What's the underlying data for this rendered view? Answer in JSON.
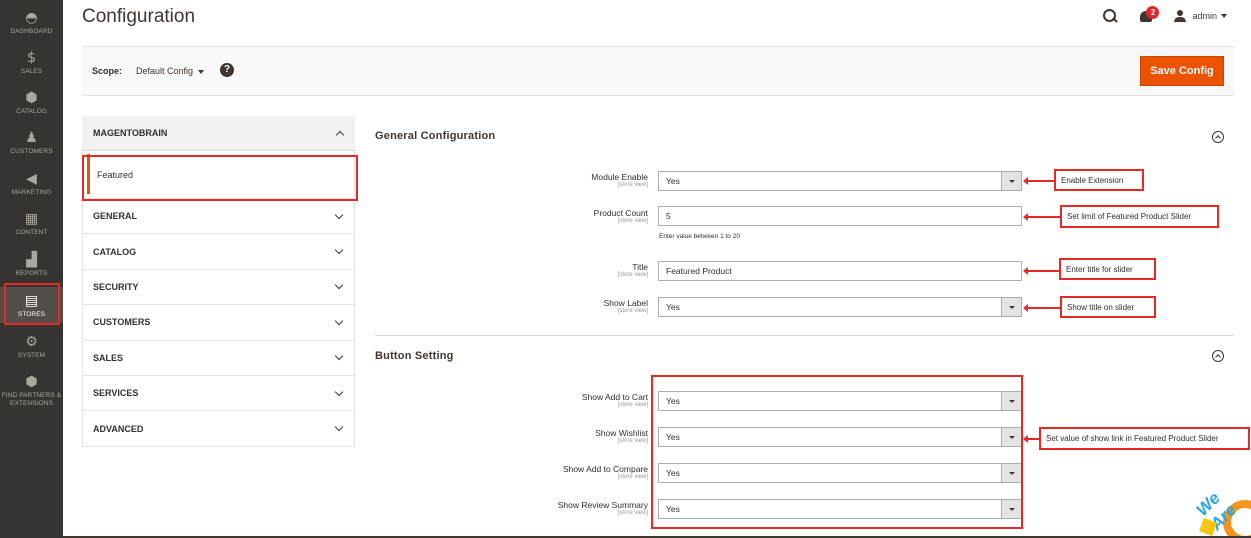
{
  "sidebar": {
    "items": [
      {
        "label": "DASHBOARD",
        "icon": "dashboard-icon",
        "glyph": "◓"
      },
      {
        "label": "SALES",
        "icon": "dollar-icon",
        "glyph": "$"
      },
      {
        "label": "CATALOG",
        "icon": "box-icon",
        "glyph": "⬢"
      },
      {
        "label": "CUSTOMERS",
        "icon": "person-icon",
        "glyph": "♟"
      },
      {
        "label": "MARKETING",
        "icon": "megaphone-icon",
        "glyph": "📢"
      },
      {
        "label": "CONTENT",
        "icon": "layout-icon",
        "glyph": "▦"
      },
      {
        "label": "REPORTS",
        "icon": "bar-chart-icon",
        "glyph": "▟"
      },
      {
        "label": "STORES",
        "icon": "store-icon",
        "glyph": "🏪"
      },
      {
        "label": "SYSTEM",
        "icon": "gear-icon",
        "glyph": "⚙"
      },
      {
        "label": "FIND PARTNERS & EXTENSIONS",
        "icon": "cube-icon",
        "glyph": "⬢"
      }
    ],
    "active": "STORES"
  },
  "header": {
    "title": "Configuration",
    "notifications_count": "2",
    "user_name": "admin"
  },
  "scope": {
    "label": "Scope:",
    "value": "Default Config",
    "help": "?",
    "save_label": "Save Config"
  },
  "tabs": {
    "magentobrain": "MAGENTOBRAIN",
    "featured": "Featured",
    "items": [
      "GENERAL",
      "CATALOG",
      "SECURITY",
      "CUSTOMERS",
      "SALES",
      "SERVICES",
      "ADVANCED"
    ]
  },
  "general": {
    "title": "General Configuration",
    "store_view": "[store view]",
    "module_enable_label": "Module Enable",
    "module_enable_value": "Yes",
    "product_count_label": "Product Count",
    "product_count_value": "5",
    "product_count_note": "Enter value between 1 to 20",
    "title_label": "Title",
    "title_value": "Featured Product",
    "show_label_label": "Show Label",
    "show_label_value": "Yes"
  },
  "button_setting": {
    "title": "Button Setting",
    "add_to_cart_label": "Show Add to Cart",
    "add_to_cart_value": "Yes",
    "wishlist_label": "Show Wishlist",
    "wishlist_value": "Yes",
    "compare_label": "Show Add to Compare",
    "compare_value": "Yes",
    "review_label": "Show Review Summary",
    "review_value": "Yes"
  },
  "annotations": {
    "enable": "Enable Extension",
    "limit": "Set limit of Featured Product Slider",
    "title": "Enter title for slider",
    "show_title": "Show title on slider",
    "links": "Set value of show link in Featured Product Slider"
  },
  "watermark": {
    "text": "We Are"
  },
  "colors": {
    "accent": "#eb5202",
    "sidebar": "#373330",
    "annotation": "#e02b27"
  }
}
